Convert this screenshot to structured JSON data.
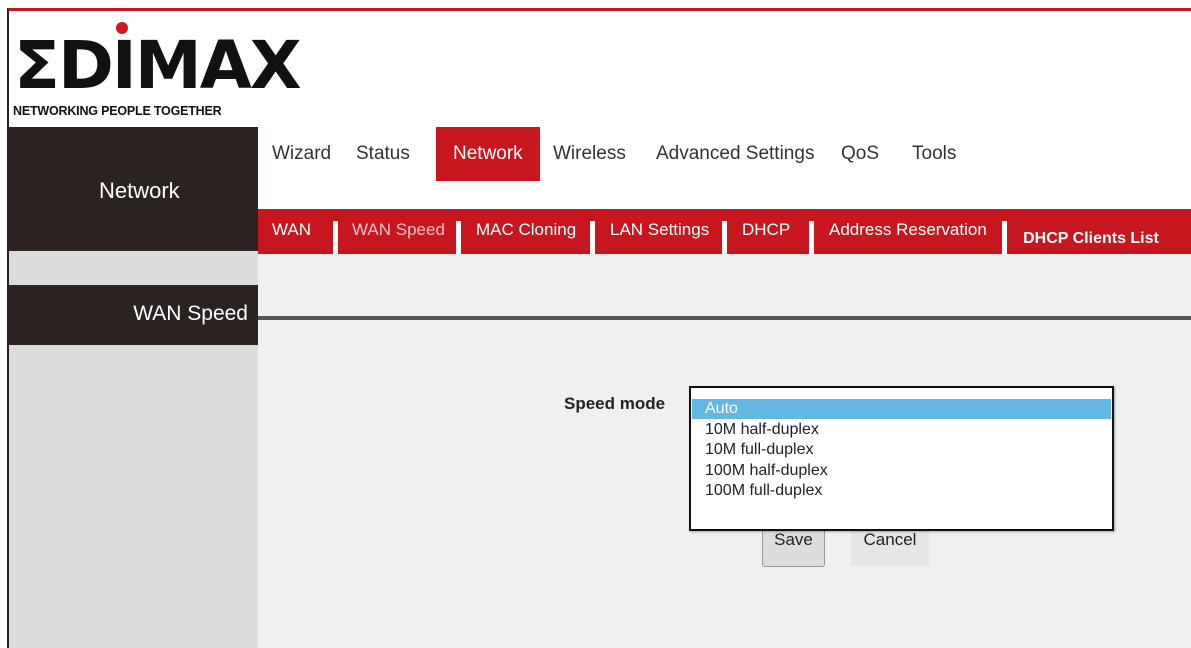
{
  "brand": {
    "logo_text": "ΣDIMAX",
    "tagline": "NETWORKING PEOPLE TOGETHER",
    "accent_color": "#c8161e"
  },
  "sidebar": {
    "section_title": "Network",
    "active_item": "WAN Speed"
  },
  "top_nav": {
    "items": [
      "Wizard",
      "Status",
      "Network",
      "Wireless",
      "Advanced Settings",
      "QoS",
      "Tools"
    ],
    "active": "Network"
  },
  "sub_nav": {
    "items": [
      "WAN",
      "WAN Speed",
      "MAC Cloning",
      "LAN Settings",
      "DHCP",
      "Address Reservation",
      "DHCP Clients List"
    ],
    "current": "WAN Speed"
  },
  "form": {
    "speed_mode_label": "Speed mode",
    "speed_mode_options": [
      "Auto",
      "10M half-duplex",
      "10M full-duplex",
      "100M half-duplex",
      "100M full-duplex"
    ],
    "selected_option": "Auto",
    "save_label": "Save",
    "cancel_label": "Cancel"
  }
}
